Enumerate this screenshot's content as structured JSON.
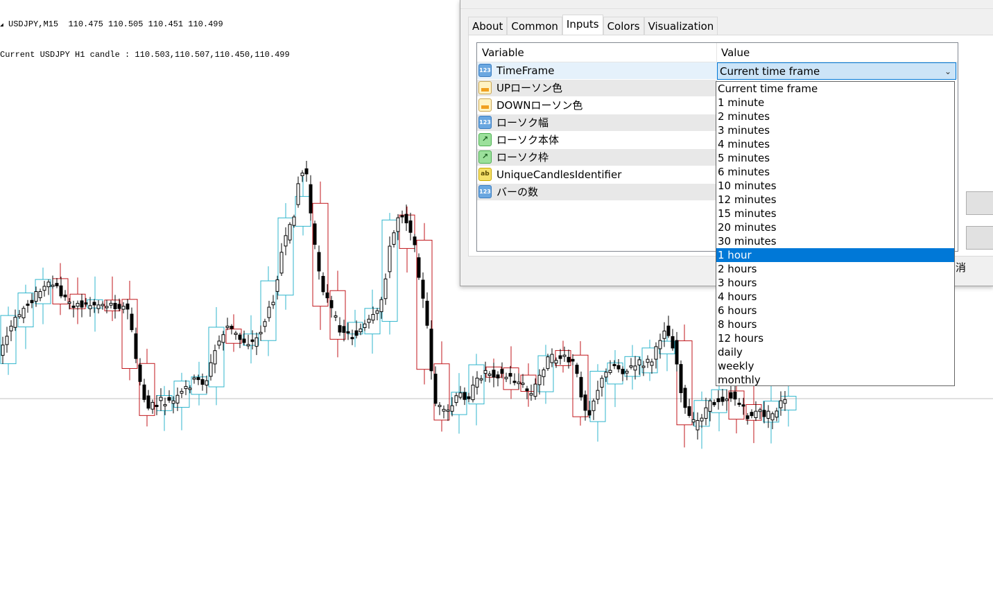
{
  "chart": {
    "header_line1": "USDJPY,M15  110.475 110.505 110.451 110.499",
    "header_line2": "Current USDJPY H1 candle : 110.503,110.507,110.450,110.499",
    "colors": {
      "up_box": "#2fb5cc",
      "down_box": "#c0161b",
      "candle": "#000000",
      "price_line": "#c0c0c0"
    }
  },
  "dialog": {
    "tabs": [
      {
        "label": "About"
      },
      {
        "label": "Common"
      },
      {
        "label": "Inputs",
        "active": true
      },
      {
        "label": "Colors"
      },
      {
        "label": "Visualization"
      }
    ],
    "grid": {
      "col_variable": "Variable",
      "col_value": "Value",
      "rows": [
        {
          "icon": "number-icon",
          "name": "TimeFrame",
          "value": "Current time frame"
        },
        {
          "icon": "color-icon",
          "name": "UPローソン色"
        },
        {
          "icon": "color-icon",
          "name": "DOWNローソン色"
        },
        {
          "icon": "number-icon",
          "name": "ローソク幅"
        },
        {
          "icon": "line-icon",
          "name": "ローソク本体"
        },
        {
          "icon": "line-icon",
          "name": "ローソク枠"
        },
        {
          "icon": "string-icon",
          "name": "UniqueCandlesIdentifier"
        },
        {
          "icon": "number-icon",
          "name": "バーの数"
        }
      ]
    },
    "partial_button_label": "消"
  },
  "dropdown": {
    "options": [
      "Current time frame",
      "1 minute",
      "2 minutes",
      "3 minutes",
      "4 minutes",
      "5 minutes",
      "6 minutes",
      "10 minutes",
      "12 minutes",
      "15 minutes",
      "20 minutes",
      "30 minutes",
      "1 hour",
      "2 hours",
      "3 hours",
      "4 hours",
      "6 hours",
      "8 hours",
      "12 hours",
      "daily",
      "weekly",
      "monthly"
    ],
    "selected_index": 12
  }
}
